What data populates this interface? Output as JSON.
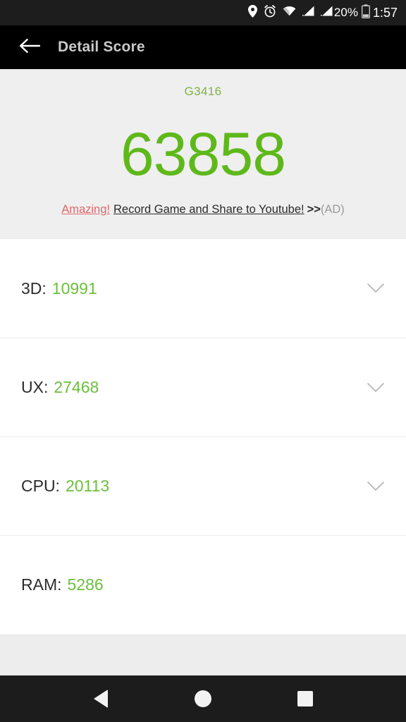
{
  "status_bar": {
    "icons": [
      "location-pin-icon",
      "alarm-clock-icon",
      "wifi-icon",
      "signal-bars-icon",
      "signal-bars-2-icon",
      "battery-icon"
    ],
    "battery_percent": "20%",
    "time": "1:57"
  },
  "app_bar": {
    "back_icon": "back-arrow-icon",
    "title": "Detail Score"
  },
  "score_card": {
    "device_name": "G3416",
    "total_score": "63858",
    "ad": {
      "highlight": "Amazing!",
      "text": "Record Game and Share to Youtube!",
      "arrows": ">>",
      "tag": "(AD)"
    }
  },
  "detail_rows": [
    {
      "label": "3D:",
      "value": "10991",
      "expandable": true,
      "chevron_icon": "chevron-down-icon"
    },
    {
      "label": "UX:",
      "value": "27468",
      "expandable": true,
      "chevron_icon": "chevron-down-icon"
    },
    {
      "label": "CPU:",
      "value": "20113",
      "expandable": true,
      "chevron_icon": "chevron-down-icon"
    },
    {
      "label": "RAM:",
      "value": "5286",
      "expandable": false,
      "chevron_icon": ""
    }
  ],
  "nav_bar": {
    "back_icon": "nav-back-triangle-icon",
    "home_icon": "nav-home-circle-icon",
    "recents_icon": "nav-recents-square-icon"
  },
  "colors": {
    "score_green": "#5fb81b",
    "value_green": "#6cbe3e",
    "device_green": "#7cb342",
    "ad_red": "#e2686c",
    "card_bg": "#efefef",
    "appbar_bg": "#000000",
    "statusbar_bg": "#1d1d1d"
  }
}
